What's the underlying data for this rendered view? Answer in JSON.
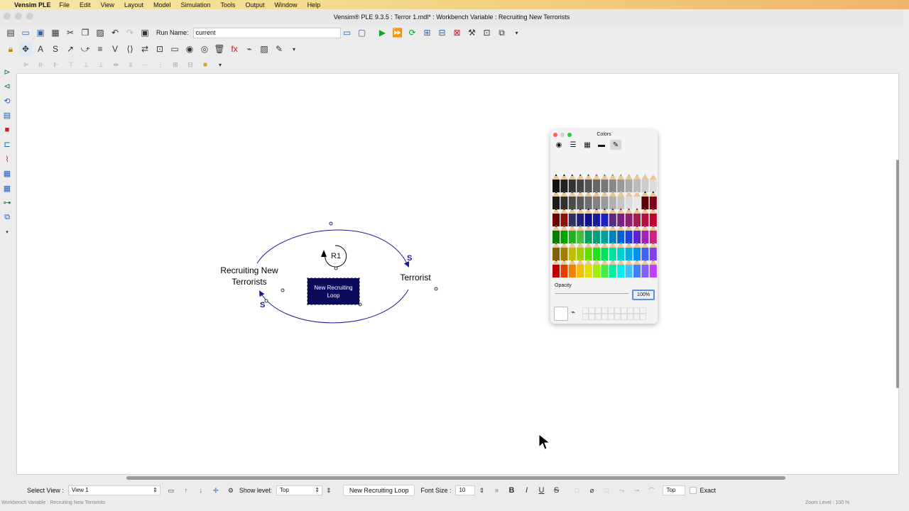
{
  "menubar": {
    "apple_icon": "apple-icon",
    "app_name": "Vensim PLE",
    "items": [
      "File",
      "Edit",
      "View",
      "Layout",
      "Model",
      "Simulation",
      "Tools",
      "Output",
      "Window",
      "Help"
    ]
  },
  "window": {
    "title": "Vensim® PLE 9.3.5 : Terror 1.mdl* : Workbench Variable : Recruiting New Terrorists"
  },
  "toolbar": {
    "run_name_label": "Run Name:",
    "run_name_value": "current"
  },
  "diagram": {
    "var_recruiting": "Recruiting New Terrorists",
    "var_terrorist": "Terrorist",
    "loop_label": "R1",
    "loop_box_text": "New Recruiting Loop",
    "polarity_top": "S",
    "polarity_bottom": "S",
    "link_color": "#1a1a9a",
    "loop_box_color": "#0b0b5c"
  },
  "colors_panel": {
    "title": "Colors",
    "opacity_label": "Opacity",
    "opacity_value": "100%"
  },
  "bottom_bar": {
    "select_view_label": "Select View :",
    "select_view_value": "View 1",
    "show_level_label": "Show level:",
    "show_level_value": "Top",
    "selected_variable": "New Recruiting Loop",
    "font_size_label": "Font Size :",
    "font_size_value": "10",
    "bold": "B",
    "italic": "I",
    "underline": "U",
    "strike": "S",
    "position_value": "Top",
    "exact_label": "Exact"
  },
  "status_bar": {
    "left": "Workbench Variable : Recruiting New Terrorists",
    "right": "Zoom Level : 100 %"
  }
}
